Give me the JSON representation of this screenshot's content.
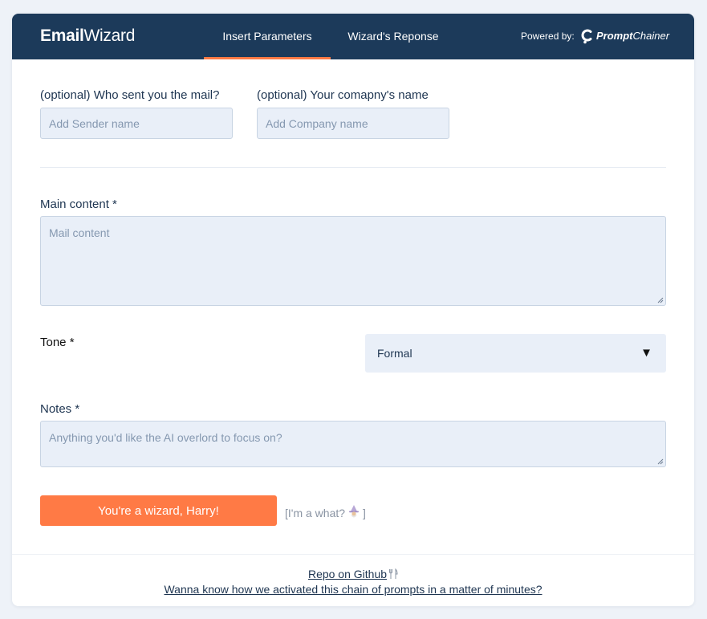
{
  "header": {
    "logo_bold": "Email",
    "logo_regular": "Wizard",
    "tabs": [
      {
        "label": "Insert Parameters",
        "active": true
      },
      {
        "label": "Wizard's Reponse",
        "active": false
      }
    ],
    "powered_by": "Powered by:",
    "powered_brand_bold": "Prompt",
    "powered_brand_regular": "Chainer"
  },
  "form": {
    "sender": {
      "label": "(optional) Who sent you the mail?",
      "placeholder": "Add Sender name",
      "value": ""
    },
    "company": {
      "label": "(optional) Your comapny's name",
      "placeholder": "Add Company name",
      "value": ""
    },
    "main_content": {
      "label": "Main content *",
      "placeholder": "Mail content",
      "value": ""
    },
    "tone": {
      "label": "Tone *",
      "selected": "Formal",
      "arrow": "▼"
    },
    "notes": {
      "label": "Notes *",
      "placeholder": "Anything you'd like the AI overlord to focus on?",
      "value": ""
    },
    "submit_label": "You're a wizard, Harry!",
    "aside_prefix": "[I'm a what?",
    "aside_suffix": "]"
  },
  "footer": {
    "repo_link": "Repo on Github",
    "promo_link": "Wanna know how we activated this chain of prompts in a matter of minutes?"
  },
  "colors": {
    "header_bg": "#1c3a5a",
    "accent": "#ff7a45",
    "input_bg": "#e9eff8",
    "page_bg": "#eef2f8"
  },
  "icons": [
    "promptchainer-logo-icon",
    "wizard-emoji-icon",
    "fork-knife-icon",
    "resize-grip-icon"
  ]
}
